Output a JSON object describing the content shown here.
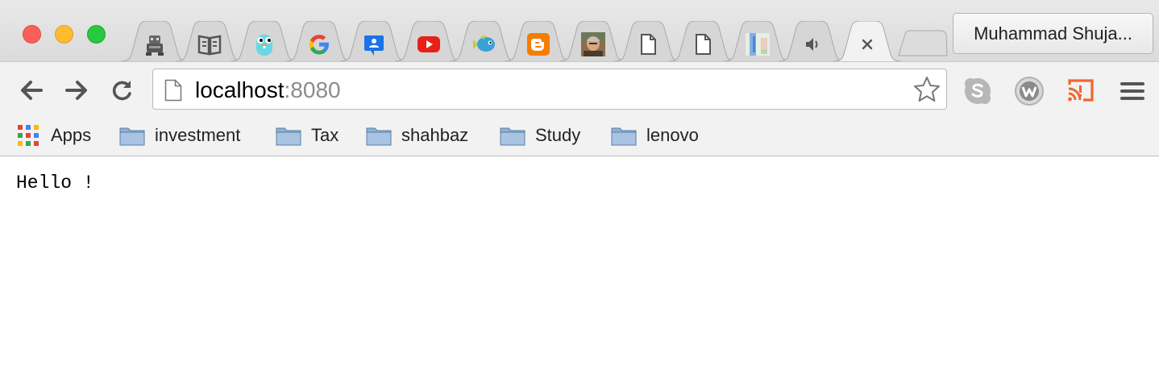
{
  "window": {
    "controls": [
      "close",
      "minimize",
      "maximize"
    ]
  },
  "tabs": [
    {
      "favicon": "robot-icon"
    },
    {
      "favicon": "book-icon"
    },
    {
      "favicon": "gopher-icon"
    },
    {
      "favicon": "google-g-icon"
    },
    {
      "favicon": "classroom-icon"
    },
    {
      "favicon": "youtube-icon"
    },
    {
      "favicon": "fish-icon"
    },
    {
      "favicon": "blogger-icon"
    },
    {
      "favicon": "portrait-photo-icon"
    },
    {
      "favicon": "blank-page-icon"
    },
    {
      "favicon": "blank-page-icon"
    },
    {
      "favicon": "colorful-thumbnail-icon"
    },
    {
      "favicon": "speaker-icon"
    },
    {
      "favicon": "close-icon",
      "active": true
    }
  ],
  "profile": {
    "name": "Muhammad Shuja..."
  },
  "toolbar": {
    "url_host": "localhost",
    "url_port": ":8080",
    "extensions": [
      "skype-icon",
      "wikiwand-w-icon",
      "cast-icon",
      "menu-icon"
    ],
    "colors": {
      "cast": "#f0672d",
      "skype": "#b7b7b7"
    }
  },
  "bookmarks": [
    {
      "label": "Apps",
      "icon": "apps-grid-icon"
    },
    {
      "label": "investment",
      "icon": "folder-icon"
    },
    {
      "label": "Tax",
      "icon": "folder-icon"
    },
    {
      "label": "shahbaz",
      "icon": "folder-icon"
    },
    {
      "label": "Study",
      "icon": "folder-icon"
    },
    {
      "label": "lenovo",
      "icon": "folder-icon"
    }
  ],
  "page": {
    "text": "Hello !"
  }
}
